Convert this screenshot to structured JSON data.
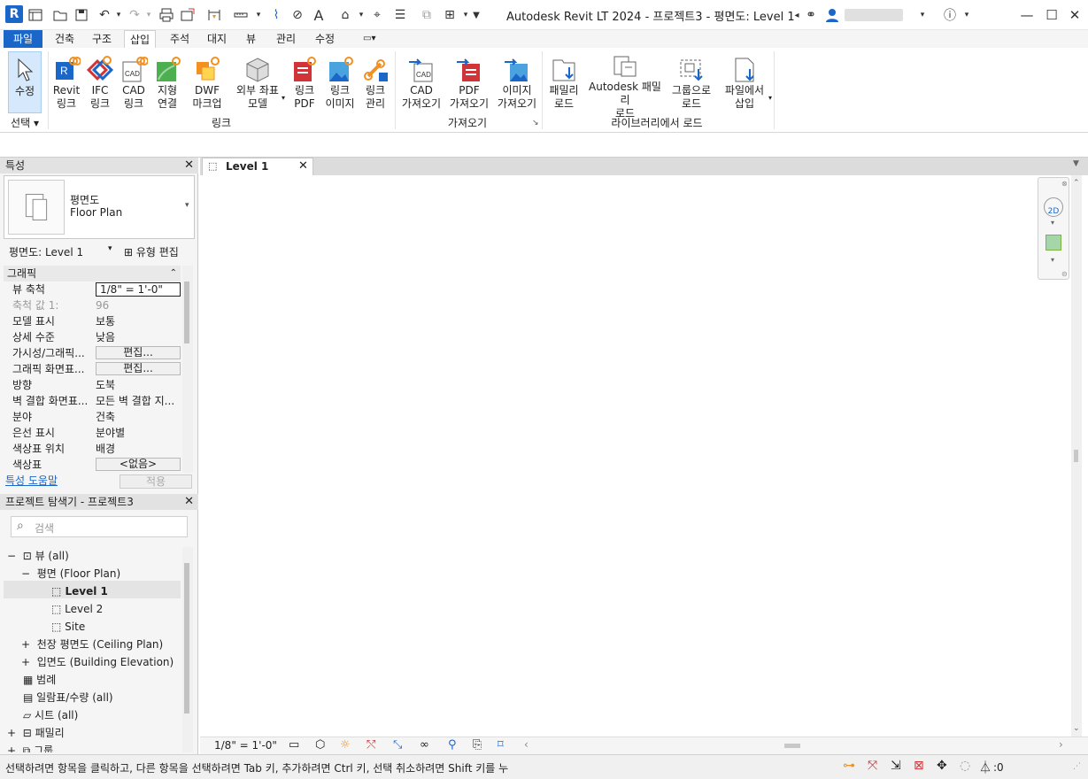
{
  "app": {
    "logo": "R",
    "title": "Autodesk Revit LT 2024 - 프로젝트3 - 평면도: Level 1"
  },
  "ribbon_tabs": [
    "파일",
    "건축",
    "구조",
    "삽입",
    "주석",
    "대지",
    "뷰",
    "관리",
    "수정"
  ],
  "ribbon": {
    "modify": {
      "line1": "수정",
      "group": "선택"
    },
    "buttons": [
      {
        "l1": "Revit",
        "l2": "링크"
      },
      {
        "l1": "IFC",
        "l2": "링크"
      },
      {
        "l1": "CAD",
        "l2": "링크"
      },
      {
        "l1": "지형",
        "l2": "연결"
      },
      {
        "l1": "DWF",
        "l2": "마크업"
      },
      {
        "l1": "외부 좌표",
        "l2": "모델"
      },
      {
        "l1": "링크",
        "l2": "PDF"
      },
      {
        "l1": "링크",
        "l2": "이미지"
      },
      {
        "l1": "링크",
        "l2": "관리"
      },
      {
        "l1": "CAD",
        "l2": "가져오기"
      },
      {
        "l1": "PDF",
        "l2": "가져오기"
      },
      {
        "l1": "이미지",
        "l2": "가져오기"
      },
      {
        "l1": "패밀리",
        "l2": "로드"
      },
      {
        "l1": "Autodesk 패밀리",
        "l2": "로드"
      },
      {
        "l1": "그룹으로",
        "l2": "로드"
      },
      {
        "l1": "파일에서",
        "l2": "삽입"
      }
    ],
    "groups": {
      "link": "링크",
      "import": "가져오기",
      "library": "라이브러리에서 로드"
    },
    "select_label": "선택"
  },
  "properties": {
    "header": "특성",
    "type_line1": "평면도",
    "type_line2": "Floor Plan",
    "instance_selector": "평면도: Level 1",
    "edit_type": "유형 편집",
    "section": "그래픽",
    "rows": [
      {
        "k": "뷰 축척",
        "v": "1/8\" = 1'-0\""
      },
      {
        "k": "축척 값    1:",
        "v": "96"
      },
      {
        "k": "모델 표시",
        "v": "보통"
      },
      {
        "k": "상세 수준",
        "v": "낮음"
      },
      {
        "k": "가시성/그래픽...",
        "v": "편집..."
      },
      {
        "k": "그래픽 화면표...",
        "v": "편집..."
      },
      {
        "k": "방향",
        "v": "도북"
      },
      {
        "k": "벽 결합 화면표...",
        "v": "모든 벽 결합 지..."
      },
      {
        "k": "분야",
        "v": "건축"
      },
      {
        "k": "은선 표시",
        "v": "분야별"
      },
      {
        "k": "색상표 위치",
        "v": "배경"
      },
      {
        "k": "색상표",
        "v": "<없음>"
      }
    ],
    "help_link": "특성 도움말",
    "apply": "적용"
  },
  "browser": {
    "header": "프로젝트 탐색기 - 프로젝트3",
    "search_placeholder": "검색",
    "items": [
      {
        "t": "뷰 (all)"
      },
      {
        "t": "평면 (Floor Plan)"
      },
      {
        "t": "Level 1"
      },
      {
        "t": "Level 2"
      },
      {
        "t": "Site"
      },
      {
        "t": "천장 평면도 (Ceiling Plan)"
      },
      {
        "t": "입면도 (Building Elevation)"
      },
      {
        "t": "범례"
      },
      {
        "t": "일람표/수량 (all)"
      },
      {
        "t": "시트 (all)"
      },
      {
        "t": "패밀리"
      },
      {
        "t": "그룹"
      }
    ]
  },
  "view": {
    "tab": "Level 1",
    "scale": "1/8\" = 1'-0\""
  },
  "status": {
    "text": "선택하려면 항목을 클릭하고, 다른 항목을 선택하려면 Tab 키, 추가하려면 Ctrl 키, 선택 취소하려면 Shift 키를 누",
    "filter_count": ":0"
  },
  "colors": {
    "accent": "#1b66c9",
    "link_blue": "#1b66c9",
    "orange": "#f29121",
    "red": "#d13438"
  }
}
